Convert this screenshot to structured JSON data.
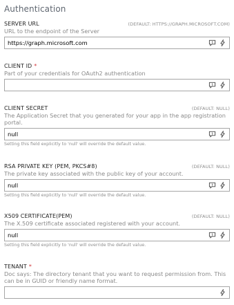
{
  "section": {
    "title": "Authentication"
  },
  "fields": [
    {
      "label": "SERVER URL",
      "required": false,
      "default": "(DEFAULT: HTTPS://GRAPH.MICROSOFT.COM)",
      "description": "URL to the endpoint of the Server",
      "value": "https://graph.microsoft.com",
      "note": ""
    },
    {
      "label": "CLIENT ID",
      "required": true,
      "default": "",
      "description": "Part of your credentials for OAuth2 authentication",
      "value": "",
      "note": ""
    },
    {
      "label": "CLIENT SECRET",
      "required": false,
      "default": "(DEFAULT: NULL)",
      "description": "The Application Secret that you generated for your app in the app registration portal.",
      "value": "null",
      "note": "Setting this field explicitly to 'null' will override the default value."
    },
    {
      "label": "RSA PRIVATE KEY (PEM, PKCS#8)",
      "required": false,
      "default": "(DEFAULT: NULL)",
      "description": "The private key associated with the public key of your account.",
      "value": "null",
      "note": "Setting this field explicitly to 'null' will override the default value."
    },
    {
      "label": "X509 CERTIFICATE(PEM)",
      "required": false,
      "default": "(DEFAULT: NULL)",
      "description": "The X.509 certificate associated registered with your account.",
      "value": "null",
      "note": "Setting this field explicitly to 'null' will override the default value."
    },
    {
      "label": "TENANT",
      "required": true,
      "default": "",
      "description": "Doc says: The directory tenant that you want to request permission from. This can be in GUID or friendly name format.",
      "value": "",
      "note": ""
    }
  ],
  "required_marker": "*",
  "colors": {
    "required": "#d13438",
    "border": "#a6a6a6",
    "muted": "#8a8a8a"
  },
  "icons": {
    "comment": "comment-icon",
    "lightning": "lightning-icon"
  }
}
